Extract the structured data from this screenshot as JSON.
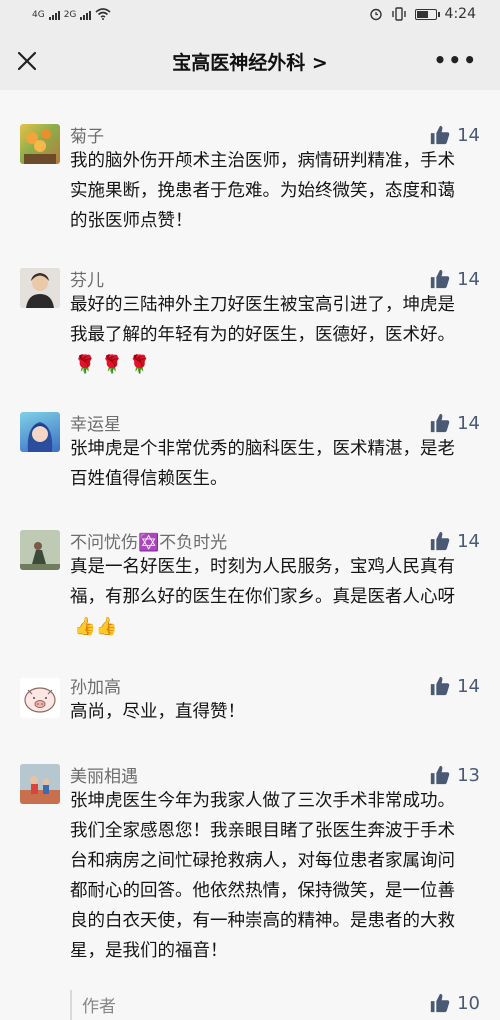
{
  "status": {
    "network1": "4G",
    "network2": "2G",
    "time": "4:24"
  },
  "nav": {
    "title": "宝高医神经外科 >",
    "more": "•••"
  },
  "comments": [
    {
      "name": "菊子",
      "likes": "14",
      "text": "我的脑外伤开颅术主治医师，病情研判精准，手术实施果断，挽患者于危难。为始终微笑，态度和蔼的张医师点赞！"
    },
    {
      "name": "芬儿",
      "likes": "14",
      "text": "最好的三陆神外主刀好医生被宝高引进了，坤虎是我最了解的年轻有为的好医生，医德好，医术好。",
      "emoji": "🌹 🌹 🌹"
    },
    {
      "name": "幸运星",
      "likes": "14",
      "text": "张坤虎是个非常优秀的脑科医生，医术精湛，是老百姓值得信赖医生。"
    },
    {
      "name": "不问忧伤✡️不负时光",
      "likes": "14",
      "text": "真是一名好医生，时刻为人民服务，宝鸡人民真有福，有那么好的医生在你们家乡。真是医者人心呀",
      "emoji": "👍👍"
    },
    {
      "name": "孙加高",
      "likes": "14",
      "text": "高尚，尽业，直得赞！"
    },
    {
      "name": "美丽相遇",
      "likes": "13",
      "text": "张坤虎医生今年为我家人做了三次手术非常成功。我们全家感恩您！我亲眼目睹了张医生奔波于手术台和病房之间忙碌抢救病人，对每位患者家属询问都耐心的回答。他依然热情，保持微笑，是一位善良的白衣天使，有一种崇高的精神。是患者的大救星，是我们的福音！"
    }
  ],
  "reply": {
    "name": "作者",
    "likes": "10"
  },
  "colors": {
    "accent": "#4a5a75",
    "name": "#6d6d6d",
    "background": "#f7f7f7"
  }
}
